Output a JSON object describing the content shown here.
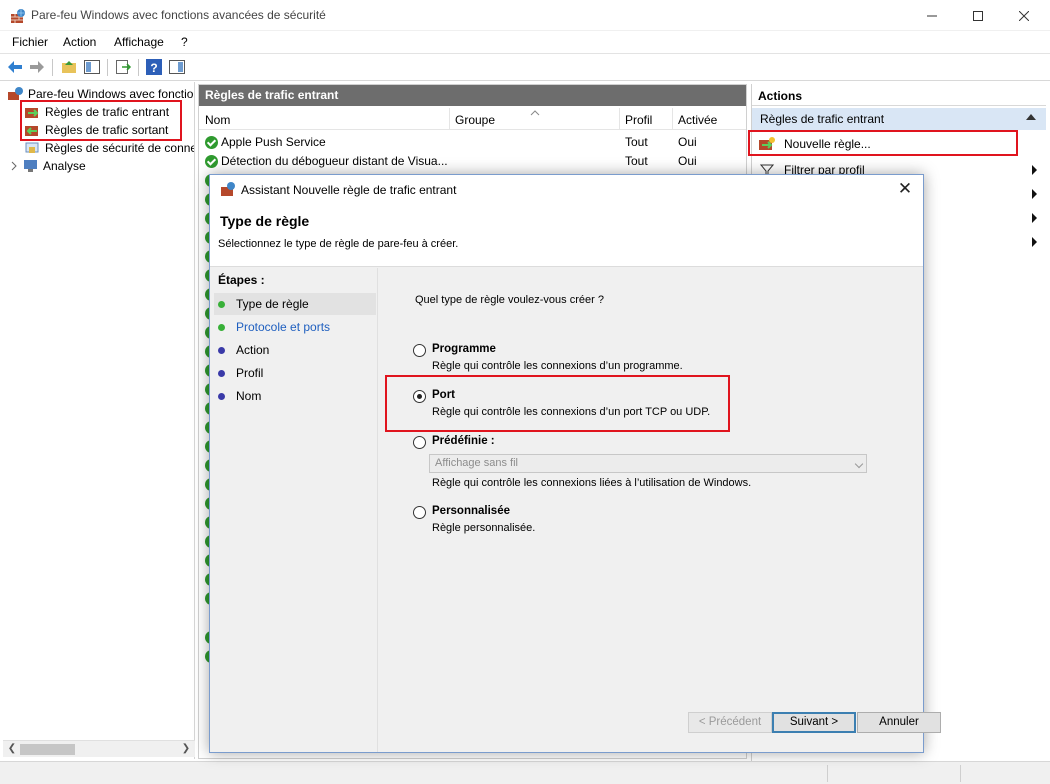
{
  "window": {
    "title": "Pare-feu Windows avec fonctions avancées de sécurité"
  },
  "menu": {
    "items": [
      "Fichier",
      "Action",
      "Affichage",
      "?"
    ]
  },
  "tree": {
    "root": "Pare-feu Windows avec fonctio",
    "items": [
      {
        "label": "Règles de trafic entrant"
      },
      {
        "label": "Règles de trafic sortant"
      },
      {
        "label": "Règles de sécurité de conne"
      },
      {
        "label": "Analyse"
      }
    ]
  },
  "center": {
    "header": "Règles de trafic entrant",
    "columns": [
      "Nom",
      "Groupe",
      "Profil",
      "Activée"
    ],
    "rows": [
      {
        "name": "Apple Push Service",
        "group": "",
        "profile": "Tout",
        "enabled": "Oui"
      },
      {
        "name": "Détection du débogueur distant de Visua...",
        "group": "",
        "profile": "Tout",
        "enabled": "Oui"
      }
    ]
  },
  "actions": {
    "header": "Actions",
    "section": "Règles de trafic entrant",
    "items": [
      {
        "label": "Nouvelle règle..."
      },
      {
        "label": "Filtrer par profil"
      }
    ]
  },
  "dialog": {
    "title": "Assistant Nouvelle règle de trafic entrant",
    "heading": "Type de règle",
    "subheading": "Sélectionnez le type de règle de pare-feu à créer.",
    "steps_title": "Étapes :",
    "steps": [
      {
        "label": "Type de règle",
        "state": "current"
      },
      {
        "label": "Protocole et ports",
        "state": "link"
      },
      {
        "label": "Action",
        "state": "pending"
      },
      {
        "label": "Profil",
        "state": "pending"
      },
      {
        "label": "Nom",
        "state": "pending"
      }
    ],
    "question": "Quel type de règle voulez-vous créer ?",
    "options": [
      {
        "title": "Programme",
        "desc": "Règle qui contrôle les connexions d’un programme.",
        "selected": false
      },
      {
        "title": "Port",
        "desc": "Règle qui contrôle les connexions d’un port TCP ou UDP.",
        "selected": true
      },
      {
        "title": "Prédéfinie :",
        "desc": "Règle qui contrôle les connexions liées à l’utilisation de Windows.",
        "selected": false
      },
      {
        "title": "Personnalisée",
        "desc": "Règle personnalisée.",
        "selected": false
      }
    ],
    "predefined_value": "Affichage sans fil",
    "buttons": {
      "prev": "< Précédent",
      "next": "Suivant >",
      "cancel": "Annuler"
    }
  },
  "colors": {
    "highlight": "#e0141e",
    "step_done": "#38b038",
    "step_pending": "#3a3aa8",
    "link": "#1f5fbf",
    "section_bg": "#d9e6f5"
  }
}
